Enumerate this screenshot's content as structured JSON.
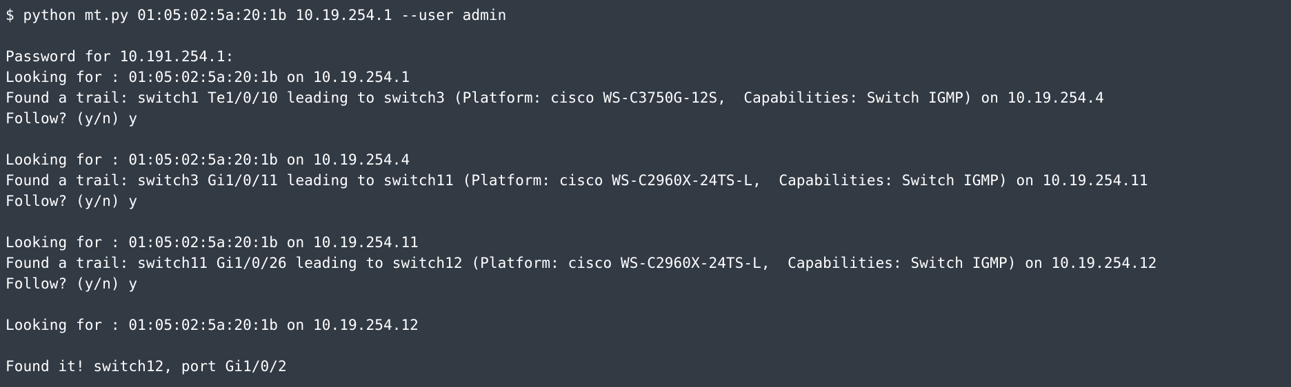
{
  "colors": {
    "background": "#323a44",
    "text": "#ffffff"
  },
  "terminal": {
    "lines": [
      "$ python mt.py 01:05:02:5a:20:1b 10.19.254.1 --user admin",
      "",
      "Password for 10.191.254.1:",
      "Looking for : 01:05:02:5a:20:1b on 10.19.254.1",
      "Found a trail: switch1 Te1/0/10 leading to switch3 (Platform: cisco WS-C3750G-12S,  Capabilities: Switch IGMP) on 10.19.254.4",
      "Follow? (y/n) y",
      "",
      "Looking for : 01:05:02:5a:20:1b on 10.19.254.4",
      "Found a trail: switch3 Gi1/0/11 leading to switch11 (Platform: cisco WS-C2960X-24TS-L,  Capabilities: Switch IGMP) on 10.19.254.11",
      "Follow? (y/n) y",
      "",
      "Looking for : 01:05:02:5a:20:1b on 10.19.254.11",
      "Found a trail: switch11 Gi1/0/26 leading to switch12 (Platform: cisco WS-C2960X-24TS-L,  Capabilities: Switch IGMP) on 10.19.254.12",
      "Follow? (y/n) y",
      "",
      "Looking for : 01:05:02:5a:20:1b on 10.19.254.12",
      "",
      "Found it! switch12, port Gi1/0/2"
    ]
  }
}
